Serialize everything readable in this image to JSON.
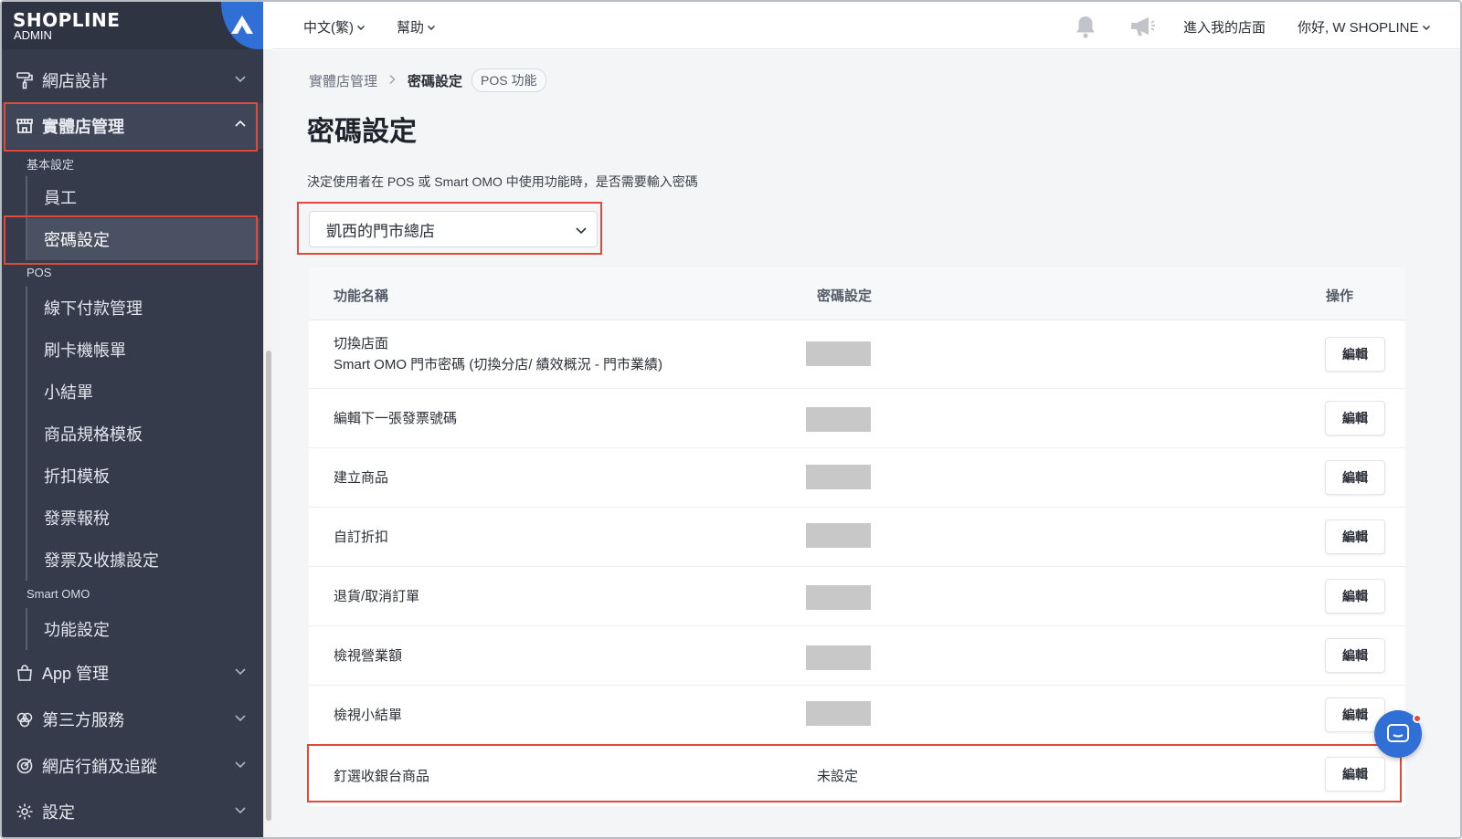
{
  "brand": {
    "logo": "SHOPLINE",
    "sub": "ADMIN"
  },
  "sidebar": {
    "top_items": [
      {
        "label": "網店設計",
        "icon": "paint-roller-icon"
      },
      {
        "label": "實體店管理",
        "icon": "store-icon"
      }
    ],
    "groups": {
      "basic": "基本設定",
      "pos": "POS",
      "smart_omo": "Smart OMO"
    },
    "basic_items": [
      "員工",
      "密碼設定"
    ],
    "pos_items": [
      "線下付款管理",
      "刷卡機帳單",
      "小結單",
      "商品規格模板",
      "折扣模板",
      "發票報稅",
      "發票及收據設定"
    ],
    "omo_items": [
      "功能設定"
    ],
    "bottom_items": [
      {
        "label": "App 管理",
        "icon": "shopping-bag-icon"
      },
      {
        "label": "第三方服務",
        "icon": "third-party-icon"
      },
      {
        "label": "網店行銷及追蹤",
        "icon": "marketing-icon"
      },
      {
        "label": "設定",
        "icon": "gear-icon"
      }
    ]
  },
  "topbar": {
    "language": "中文(繁)",
    "help": "幫助",
    "enter_store": "進入我的店面",
    "greeting": "你好, W SHOPLINE"
  },
  "breadcrumb": {
    "parent": "實體店管理",
    "current": "密碼設定",
    "badge": "POS 功能"
  },
  "page": {
    "title": "密碼設定",
    "description": "決定使用者在 POS 或 Smart OMO 中使用功能時，是否需要輸入密碼",
    "store_select": "凱西的門市總店"
  },
  "table": {
    "headers": {
      "name": "功能名稱",
      "password": "密碼設定",
      "action": "操作"
    },
    "rows": [
      {
        "name_line1": "切換店面",
        "name_line2": "Smart OMO 門市密碼 (切換分店/ 績效概況 - 門市業績)",
        "password": "",
        "action": "編輯"
      },
      {
        "name_line1": "編輯下一張發票號碼",
        "password": "",
        "action": "編輯"
      },
      {
        "name_line1": "建立商品",
        "password": "",
        "action": "編輯"
      },
      {
        "name_line1": "自訂折扣",
        "password": "",
        "action": "編輯"
      },
      {
        "name_line1": "退貨/取消訂單",
        "password": "",
        "action": "編輯"
      },
      {
        "name_line1": "檢視營業額",
        "password": "",
        "action": "編輯"
      },
      {
        "name_line1": "檢視小結單",
        "password": "",
        "action": "編輯"
      },
      {
        "name_line1": "釘選收銀台商品",
        "password": "未設定",
        "action": "編輯"
      }
    ]
  },
  "colors": {
    "sidebar_bg": "#353b4b",
    "accent": "#2f6fd6",
    "highlight": "#e04a3a"
  }
}
